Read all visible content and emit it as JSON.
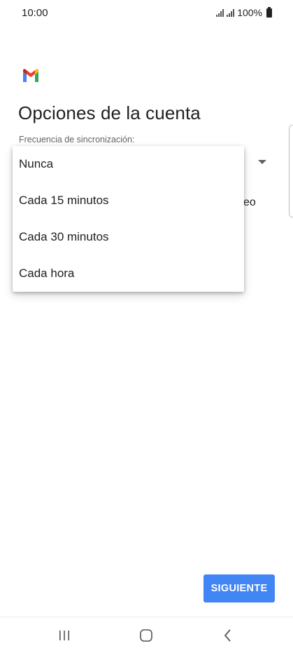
{
  "status_bar": {
    "time": "10:00",
    "battery_text": "100%"
  },
  "app": {
    "icon": "gmail-logo",
    "title": "Opciones de la cuenta"
  },
  "sync": {
    "label": "Frecuencia de sincronización:",
    "partial_text_behind_menu": "eo"
  },
  "popup_menu": {
    "items": [
      "Nunca",
      "Cada 15 minutos",
      "Cada 30 minutos",
      "Cada hora"
    ]
  },
  "next_button": {
    "label": "SIGUIENTE",
    "color": "#4285f4"
  },
  "nav_bar": {
    "icons": [
      "recent-apps-icon",
      "home-icon",
      "back-icon"
    ]
  }
}
